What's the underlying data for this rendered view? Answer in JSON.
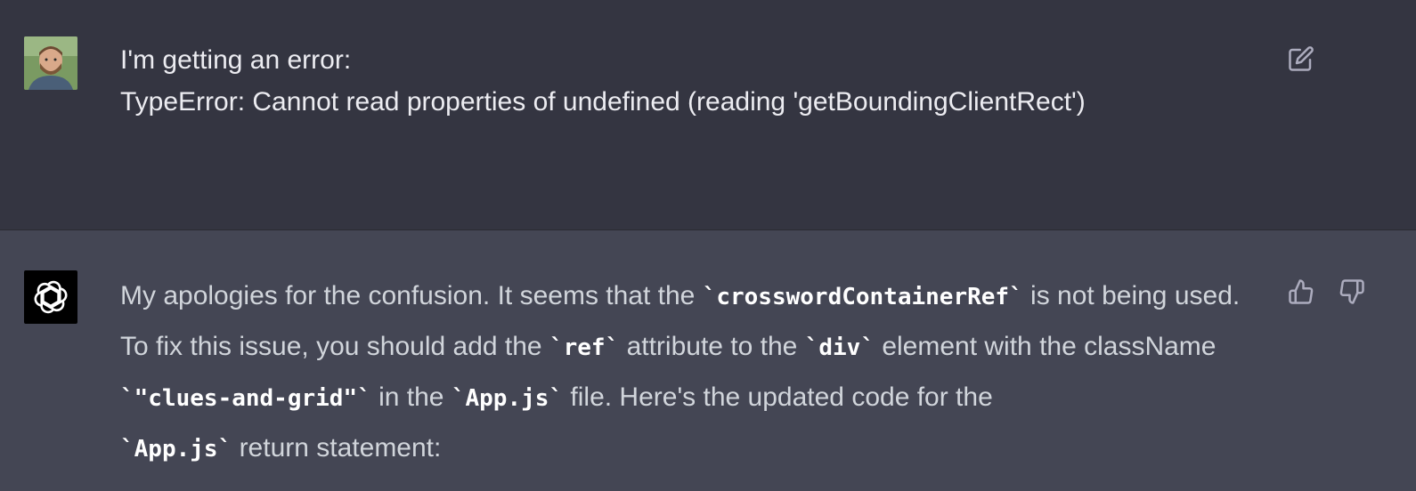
{
  "user_message": {
    "lines": [
      "I'm getting an error:",
      "TypeError: Cannot read properties of undefined (reading 'getBoundingClientRect')"
    ],
    "avatar_icon": "user-photo-avatar",
    "edit_icon": "edit-icon"
  },
  "assistant_message": {
    "avatar_icon": "openai-logo-icon",
    "segments": [
      {
        "type": "text",
        "value": "My apologies for the confusion. It seems that the "
      },
      {
        "type": "code",
        "value": "`crosswordContainerRef`"
      },
      {
        "type": "text",
        "value": " is not being used. To fix this issue, you should add the "
      },
      {
        "type": "code",
        "value": "`ref`"
      },
      {
        "type": "text",
        "value": " attribute to the "
      },
      {
        "type": "code",
        "value": "`div`"
      },
      {
        "type": "text",
        "value": " element with the className "
      },
      {
        "type": "code",
        "value": "`\"clues-and-grid\"`"
      },
      {
        "type": "text",
        "value": " in the "
      },
      {
        "type": "code",
        "value": "`App.js`"
      },
      {
        "type": "text",
        "value": " file. Here's the updated code for the "
      },
      {
        "type": "code",
        "value": "`App.js`"
      },
      {
        "type": "text",
        "value": " return statement:"
      }
    ],
    "feedback_icons": [
      "thumbs-up-icon",
      "thumbs-down-icon"
    ]
  },
  "colors": {
    "user_bg": "#343541",
    "assistant_bg": "#444654",
    "text": "#ececf1",
    "assistant_text": "#d1d5db",
    "icon": "#acacbe"
  }
}
